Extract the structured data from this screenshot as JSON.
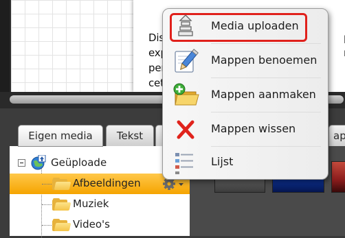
{
  "document": {
    "lines": [
      "Diss",
      "expe",
      "pers",
      "cete"
    ],
    "right_fragments": [
      "pe",
      "rp",
      "v",
      "e"
    ]
  },
  "tabs": {
    "eigen_media": "Eigen media",
    "tekst": "Tekst",
    "right_partial": "ap"
  },
  "tree": {
    "root": "Geüploade",
    "items": [
      "Afbeeldingen",
      "Muziek",
      "Video's"
    ],
    "root_expander": "−"
  },
  "context_menu": {
    "items": [
      {
        "label": "Media uploaden",
        "icon": "upload-icon"
      },
      {
        "label": "Mappen benoemen",
        "icon": "rename-pencil-icon"
      },
      {
        "label": "Mappen aanmaken",
        "icon": "new-folder-icon"
      },
      {
        "label": "Mappen wissen",
        "icon": "delete-x-icon"
      },
      {
        "label": "Lijst",
        "icon": "list-view-icon"
      }
    ]
  },
  "colors": {
    "selection": "#f5a400",
    "highlight_border": "#e0201b"
  }
}
